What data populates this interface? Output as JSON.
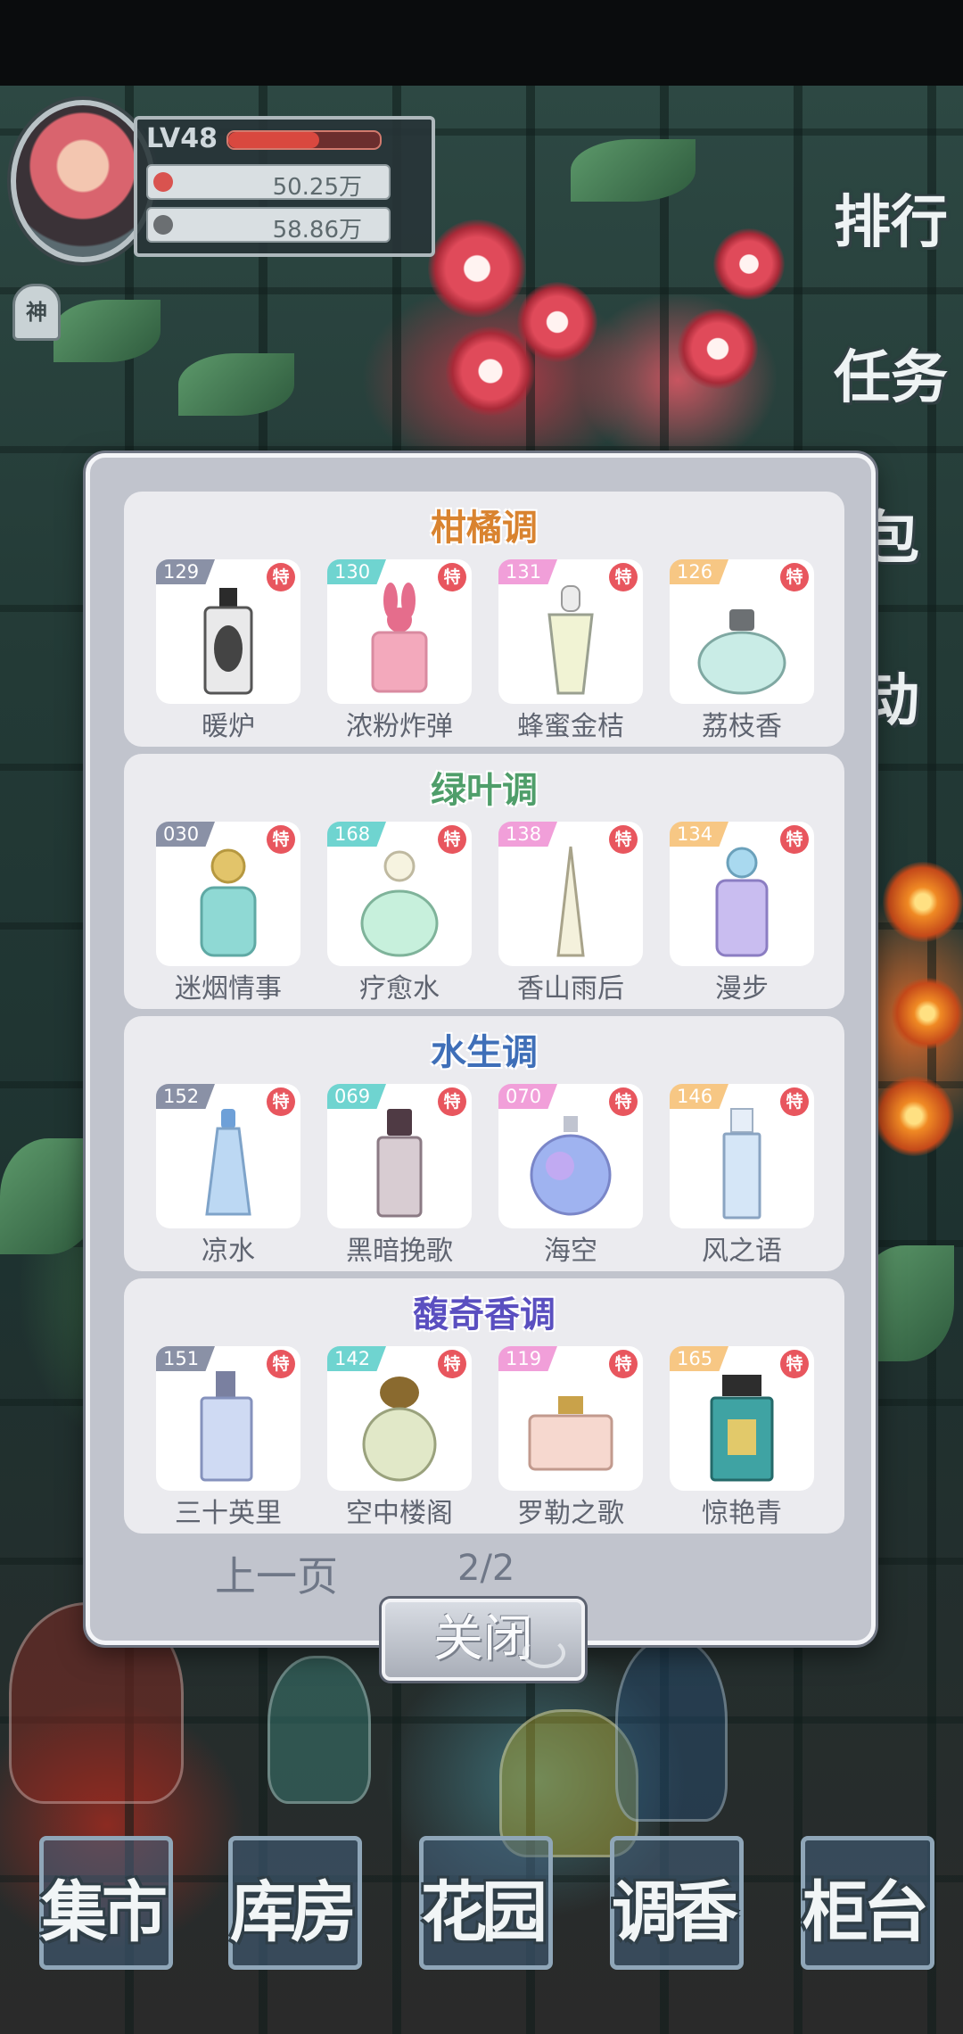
{
  "player": {
    "level": "LV48",
    "exp_fraction": 0.6,
    "currency1": "50.25万",
    "currency2": "58.86万",
    "badge": "神"
  },
  "side_buttons": [
    "排行",
    "任务",
    "包",
    "动"
  ],
  "dialog": {
    "sections": [
      {
        "title": "柑橘调",
        "title_color": "#d9832f",
        "items": [
          {
            "num": "129",
            "tag": "特",
            "name": "暖炉",
            "num_color": "#8a91a6"
          },
          {
            "num": "130",
            "tag": "特",
            "name": "浓粉炸弹",
            "num_color": "#6fd4d0"
          },
          {
            "num": "131",
            "tag": "特",
            "name": "蜂蜜金桔",
            "num_color": "#f19fd9"
          },
          {
            "num": "126",
            "tag": "特",
            "name": "荔枝香",
            "num_color": "#f7c784"
          }
        ]
      },
      {
        "title": "绿叶调",
        "title_color": "#4f9e6a",
        "items": [
          {
            "num": "030",
            "tag": "特",
            "name": "迷烟情事",
            "num_color": "#8a91a6"
          },
          {
            "num": "168",
            "tag": "特",
            "name": "疗愈水",
            "num_color": "#6fd4d0"
          },
          {
            "num": "138",
            "tag": "特",
            "name": "香山雨后",
            "num_color": "#f19fd9"
          },
          {
            "num": "134",
            "tag": "特",
            "name": "漫步",
            "num_color": "#f7c784"
          }
        ]
      },
      {
        "title": "水生调",
        "title_color": "#3f6fb8",
        "items": [
          {
            "num": "152",
            "tag": "特",
            "name": "凉水",
            "num_color": "#8a91a6"
          },
          {
            "num": "069",
            "tag": "特",
            "name": "黑暗挽歌",
            "num_color": "#6fd4d0"
          },
          {
            "num": "070",
            "tag": "特",
            "name": "海空",
            "num_color": "#f19fd9"
          },
          {
            "num": "146",
            "tag": "特",
            "name": "风之语",
            "num_color": "#f7c784"
          }
        ]
      },
      {
        "title": "馥奇香调",
        "title_color": "#5a4fc0",
        "items": [
          {
            "num": "151",
            "tag": "特",
            "name": "三十英里",
            "num_color": "#8a91a6"
          },
          {
            "num": "142",
            "tag": "特",
            "name": "空中楼阁",
            "num_color": "#6fd4d0"
          },
          {
            "num": "119",
            "tag": "特",
            "name": "罗勒之歌",
            "num_color": "#f19fd9"
          },
          {
            "num": "165",
            "tag": "特",
            "name": "惊艳青",
            "num_color": "#f7c784"
          }
        ]
      }
    ],
    "prev_label": "上一页",
    "page_indicator": "2/2",
    "close_label": "关闭"
  },
  "bottom_nav": [
    {
      "label": "集市"
    },
    {
      "label": "库房"
    },
    {
      "label": "花园"
    },
    {
      "label": "调香"
    },
    {
      "label": "柜台"
    }
  ]
}
